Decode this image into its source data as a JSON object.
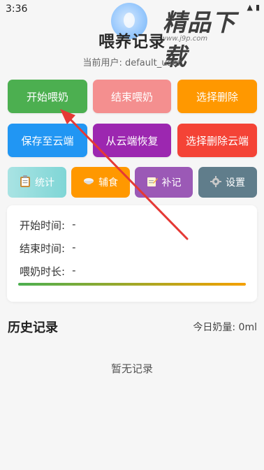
{
  "status_bar": {
    "time": "3:36",
    "signal": "▲",
    "battery": "▮"
  },
  "watermark": {
    "text": "精品下载",
    "url": "www.j9p.com"
  },
  "header": {
    "title": "喂养记录",
    "current_user_label": "当前用户: default_user"
  },
  "actions_row1": {
    "start_feeding": "开始喂奶",
    "end_feeding": "结束喂奶",
    "select_delete": "选择删除"
  },
  "actions_row2": {
    "save_cloud": "保存至云端",
    "restore_cloud": "从云端恢复",
    "select_delete_cloud": "选择删除云端"
  },
  "actions_row3": {
    "stats": {
      "icon": "clipboard-icon",
      "label": "统计"
    },
    "complementary": {
      "icon": "bowl-icon",
      "label": "辅食"
    },
    "supplement": {
      "icon": "memo-icon",
      "label": "补记"
    },
    "settings": {
      "icon": "gear-icon",
      "label": "设置"
    }
  },
  "session": {
    "start_label": "开始时间:",
    "start_value": "-",
    "end_label": "结束时间:",
    "end_value": "-",
    "duration_label": "喂奶时长:",
    "duration_value": "-",
    "progress": 1.0
  },
  "history": {
    "title": "历史记录",
    "today_amount": "今日奶量: 0ml",
    "empty_text": "暂无记录"
  },
  "colors": {
    "start": "#4caf50",
    "end": "#f48f8f",
    "select_delete": "#ff9800",
    "save_cloud": "#2196f3",
    "restore_cloud": "#9c27b0",
    "delete_cloud": "#f44336",
    "stats": "#7fd6d6",
    "complementary": "#ff9800",
    "supplement": "#9b59b6",
    "settings": "#607d8b",
    "annotation_arrow": "#e53935"
  }
}
